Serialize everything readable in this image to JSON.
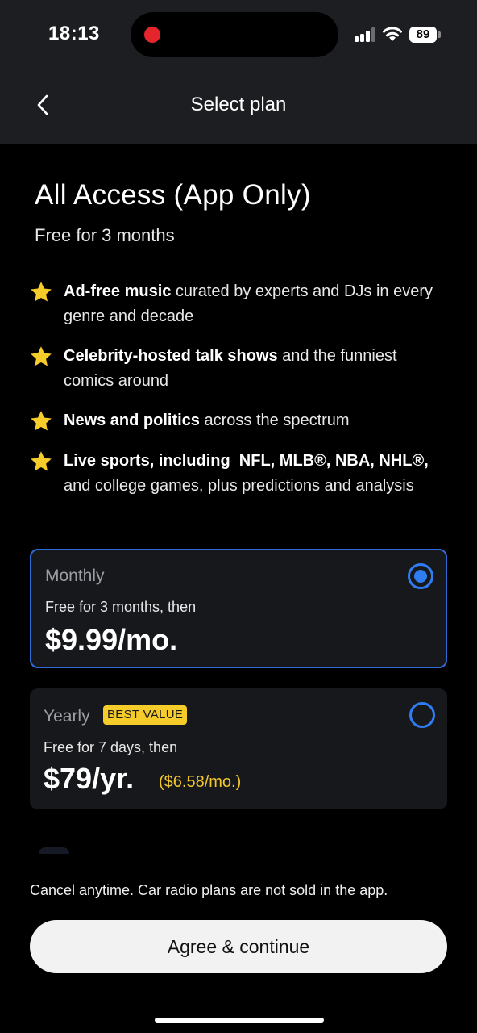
{
  "status_bar": {
    "time": "18:13",
    "battery": "89"
  },
  "header": {
    "title": "Select plan"
  },
  "plan": {
    "title": "All Access (App Only)",
    "subtitle": "Free for 3 months"
  },
  "features": [
    {
      "bold": "Ad-free music",
      "rest": " curated by experts and DJs in every genre and decade"
    },
    {
      "bold": "Celebrity-hosted talk shows",
      "rest": " and the funniest comics around"
    },
    {
      "bold": "News and politics",
      "rest": " across the spectrum"
    },
    {
      "bold": "Live sports, including  NFL, MLB®, NBA, NHL®,",
      "rest": " and college games, plus predictions and analysis"
    }
  ],
  "options": {
    "monthly": {
      "label": "Monthly",
      "note": "Free for 3 months, then",
      "price": "$9.99/mo.",
      "selected": true
    },
    "yearly": {
      "label": "Yearly",
      "badge": "BEST VALUE",
      "note": "Free for 7 days, then",
      "price": "$79/yr.",
      "per_month": "($6.58/mo.)",
      "selected": false
    }
  },
  "footer": {
    "note": "Cancel anytime. Car radio plans are not sold in the app.",
    "cta_label": "Agree & continue"
  },
  "colors": {
    "accent": "#2e7df2",
    "badge": "#f6cc2b",
    "star": "#f6cc2b",
    "recording": "#e5252c"
  },
  "icons": [
    "back-chevron-icon",
    "star-icon",
    "signal-icon",
    "wifi-icon",
    "battery-icon",
    "radio-icon"
  ]
}
